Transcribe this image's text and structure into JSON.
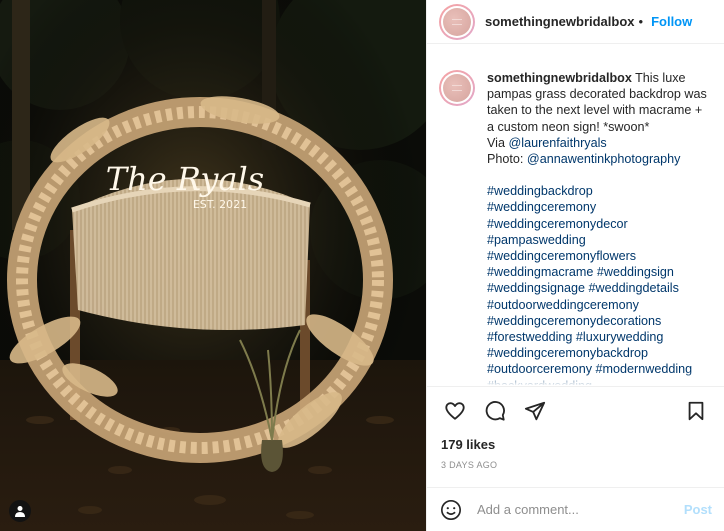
{
  "header": {
    "username": "somethingnewbridalbox",
    "separator": "•",
    "follow_label": "Follow"
  },
  "photo": {
    "description_icon": "user-tag-icon",
    "sign_text_main": "The Ryals",
    "sign_text_sub": "EST. 2021"
  },
  "caption": {
    "username": "somethingnewbridalbox",
    "text": " This luxe pampas grass decorated backdrop was taken to the next level with macrame + a custom neon sign! *swoon*",
    "via_prefix": "Via ",
    "via_handle": "@laurenfaithryals",
    "photo_prefix": "Photo: ",
    "photo_handle": "@annawentinkphotography",
    "hashtags": [
      "#weddingbackdrop",
      "#weddingceremony",
      "#weddingceremonydecor",
      "#pampaswedding",
      "#weddingceremonyflowers",
      "#weddingmacrame #weddingsign",
      "#weddingsignage #weddingdetails",
      "#outdoorweddingceremony",
      "#weddingceremonydecorations",
      "#forestwedding #luxurywedding",
      "#weddingceremonybackdrop",
      "#outdoorceremony #modernwedding",
      "#backyardwedding"
    ]
  },
  "actions": {
    "icons": [
      "heart-icon",
      "comment-icon",
      "share-icon",
      "bookmark-icon"
    ]
  },
  "likes_label": "179 likes",
  "date_label": "3 DAYS AGO",
  "comment_box": {
    "placeholder": "Add a comment...",
    "post_label": "Post"
  },
  "colors": {
    "accent": "#0095f6",
    "link": "#00376b",
    "post_disabled": "#b2dffc",
    "muted": "#8e8e8e"
  }
}
